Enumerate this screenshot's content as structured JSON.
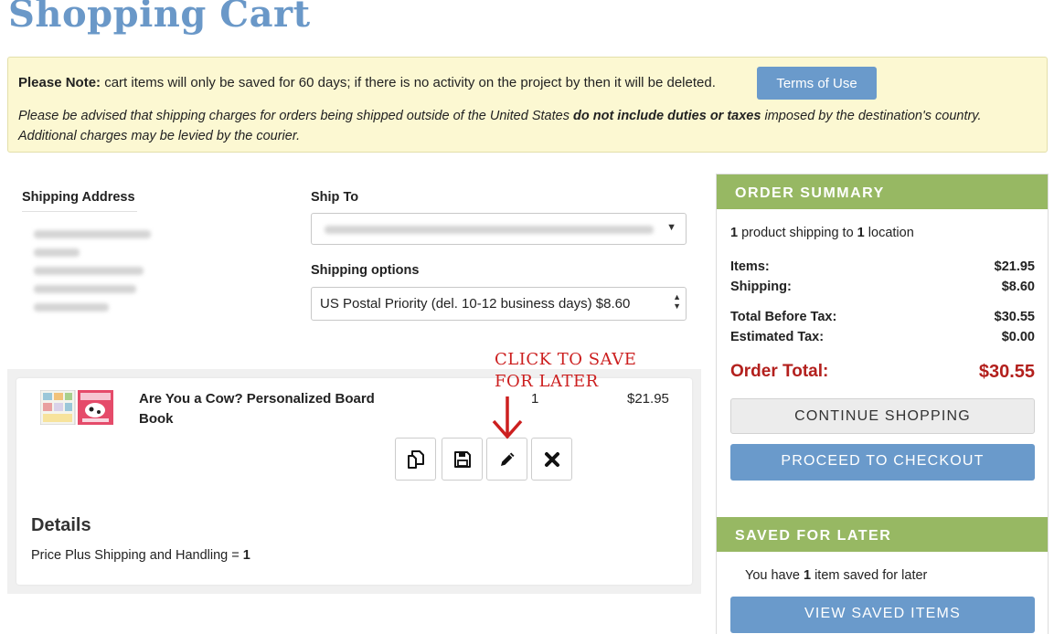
{
  "page_title": "Shopping Cart",
  "notice": {
    "note_label": "Please Note:",
    "note_text": " cart items will only be saved for 60 days; if there is no activity on the project by then it will be deleted.",
    "terms_button": "Terms of Use",
    "advisory_pre": "Please be advised that shipping charges for orders being shipped outside of the United States ",
    "advisory_bold": "do not include duties or taxes",
    "advisory_post": " imposed by the destination's country. Additional charges may be levied by the courier."
  },
  "shipping": {
    "address_label": "Shipping Address",
    "ship_to_label": "Ship To",
    "shipping_options_label": "Shipping options",
    "shipping_option_selected": "US Postal Priority (del. 10-12 business days) $8.60"
  },
  "cart_item": {
    "name": "Are You a Cow? Personalized Board Book",
    "quantity": "1",
    "price": "$21.95",
    "details_title": "Details",
    "details_label": "Price Plus Shipping and Handling = ",
    "details_value": "1"
  },
  "annotation": {
    "line1": "CLICK TO SAVE",
    "line2": "FOR LATER",
    "color": "#cc1f1f"
  },
  "summary": {
    "header": "ORDER SUMMARY",
    "count_products": "1",
    "count_mid": " product shipping to ",
    "count_locations": "1",
    "count_end": " location",
    "items_label": "Items:",
    "items_value": "$21.95",
    "shipping_label": "Shipping:",
    "shipping_value": "$8.60",
    "before_tax_label": "Total Before Tax:",
    "before_tax_value": "$30.55",
    "tax_label": "Estimated Tax:",
    "tax_value": "$0.00",
    "total_label": "Order Total:",
    "total_value": "$30.55",
    "continue_button": "CONTINUE SHOPPING",
    "checkout_button": "PROCEED TO CHECKOUT"
  },
  "saved": {
    "header": "SAVED FOR LATER",
    "pre": "You have ",
    "count": "1",
    "post": " item saved for later",
    "view_button": "VIEW SAVED ITEMS"
  },
  "colors": {
    "title_blue": "#6a98c8",
    "button_blue": "#6a9acb",
    "header_green": "#97b863",
    "total_red": "#b3201d",
    "notice_bg": "#fcf8d2"
  },
  "icons": [
    "duplicate-icon",
    "save-icon",
    "pencil-icon",
    "close-icon",
    "dropdown-caret-icon",
    "select-updown-icon",
    "arrow-down-icon"
  ]
}
